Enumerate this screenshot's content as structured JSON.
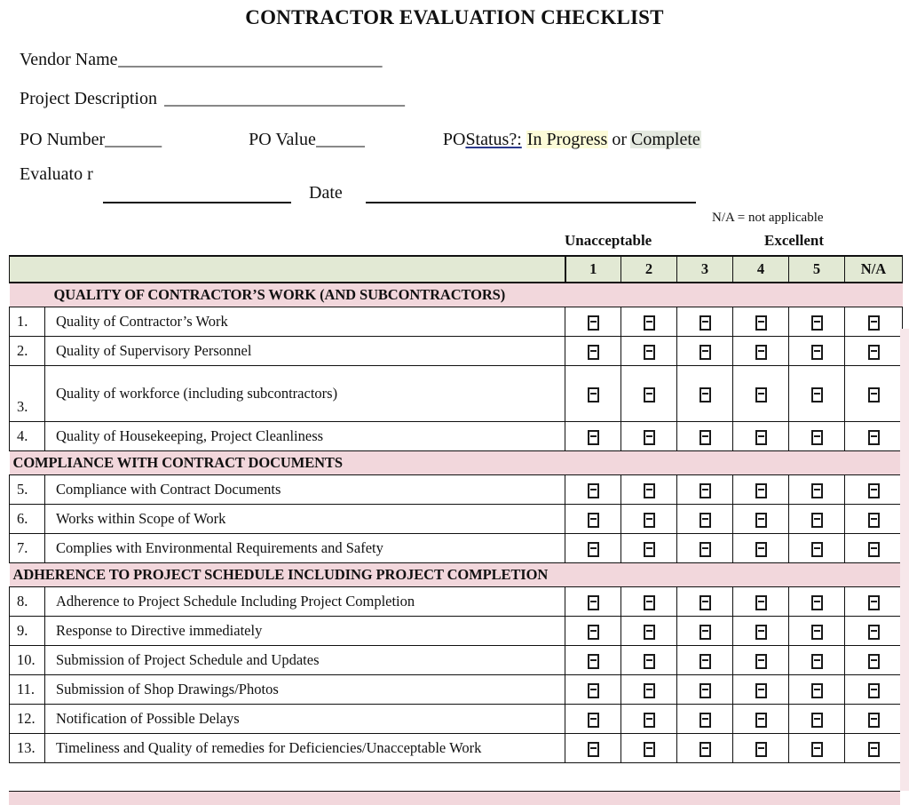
{
  "document": {
    "title": "CONTRACTOR EVALUATION CHECKLIST"
  },
  "form": {
    "vendor_name_label": "Vendor Name",
    "vendor_name_rule": "_________________________________",
    "project_description_label": "Project Description",
    "project_description_rule": "______________________________",
    "po_number_label": "PO Number",
    "po_number_rule": "_______",
    "po_value_label": "PO Value",
    "po_value_rule": "______",
    "po_status_prefix": "PO ",
    "po_status_label": "Status?:",
    "po_status_option_in_progress": "In Progress",
    "po_status_conjunction": "or",
    "po_status_option_complete": "Complete",
    "evaluator_label": "Evaluato\nr",
    "date_label": "Date",
    "na_note": "N/A = not applicable"
  },
  "scale": {
    "low_caption": "Unacceptable",
    "high_caption": "Excellent",
    "columns": [
      "1",
      "2",
      "3",
      "4",
      "5",
      "N/A"
    ]
  },
  "colors": {
    "section_header_bg": "#f2d7dc",
    "rating_header_bg": "#e2e9d4",
    "highlight_yellow": "#fcfbd8",
    "highlight_green": "#e4e9e0",
    "status_underline": "#2c3a8c",
    "border": "#111111"
  },
  "sections": [
    {
      "heading": "QUALITY OF CONTRACTOR’S WORK (AND SUBCONTRACTORS)",
      "indented": true,
      "items": [
        {
          "number": "1.",
          "text": "Quality of Contractor’s Work",
          "tall": false
        },
        {
          "number": "2.",
          "text": "Quality of Supervisory Personnel",
          "tall": false
        },
        {
          "number": "3.",
          "text": "Quality of workforce (including subcontractors)",
          "tall": true
        },
        {
          "number": "4.",
          "text": "Quality of Housekeeping, Project Cleanliness",
          "tall": false
        }
      ]
    },
    {
      "heading": "COMPLIANCE WITH CONTRACT DOCUMENTS",
      "indented": false,
      "items": [
        {
          "number": "5.",
          "text": "Compliance with Contract Documents",
          "tall": false
        },
        {
          "number": "6.",
          "text": "Works within Scope of Work",
          "tall": false
        },
        {
          "number": "7.",
          "text": "Complies with Environmental Requirements and Safety",
          "tall": false
        }
      ]
    },
    {
      "heading": "ADHERENCE TO PROJECT SCHEDULE INCLUDING PROJECT COMPLETION",
      "indented": false,
      "items": [
        {
          "number": "8.",
          "text": "Adherence to Project Schedule Including Project Completion",
          "tall": false
        },
        {
          "number": "9.",
          "text": "Response to Directive immediately",
          "tall": false
        },
        {
          "number": "10.",
          "text": "Submission of Project Schedule and Updates",
          "tall": false
        },
        {
          "number": "11.",
          "text": "Submission of Shop Drawings/Photos",
          "tall": false
        },
        {
          "number": "12.",
          "text": "Notification of Possible Delays",
          "tall": false
        },
        {
          "number": "13.",
          "text": "Timeliness and Quality of remedies for Deficiencies/Unacceptable Work",
          "tall": false
        }
      ]
    }
  ],
  "icons": {
    "checkbox": "checkbox-icon"
  }
}
